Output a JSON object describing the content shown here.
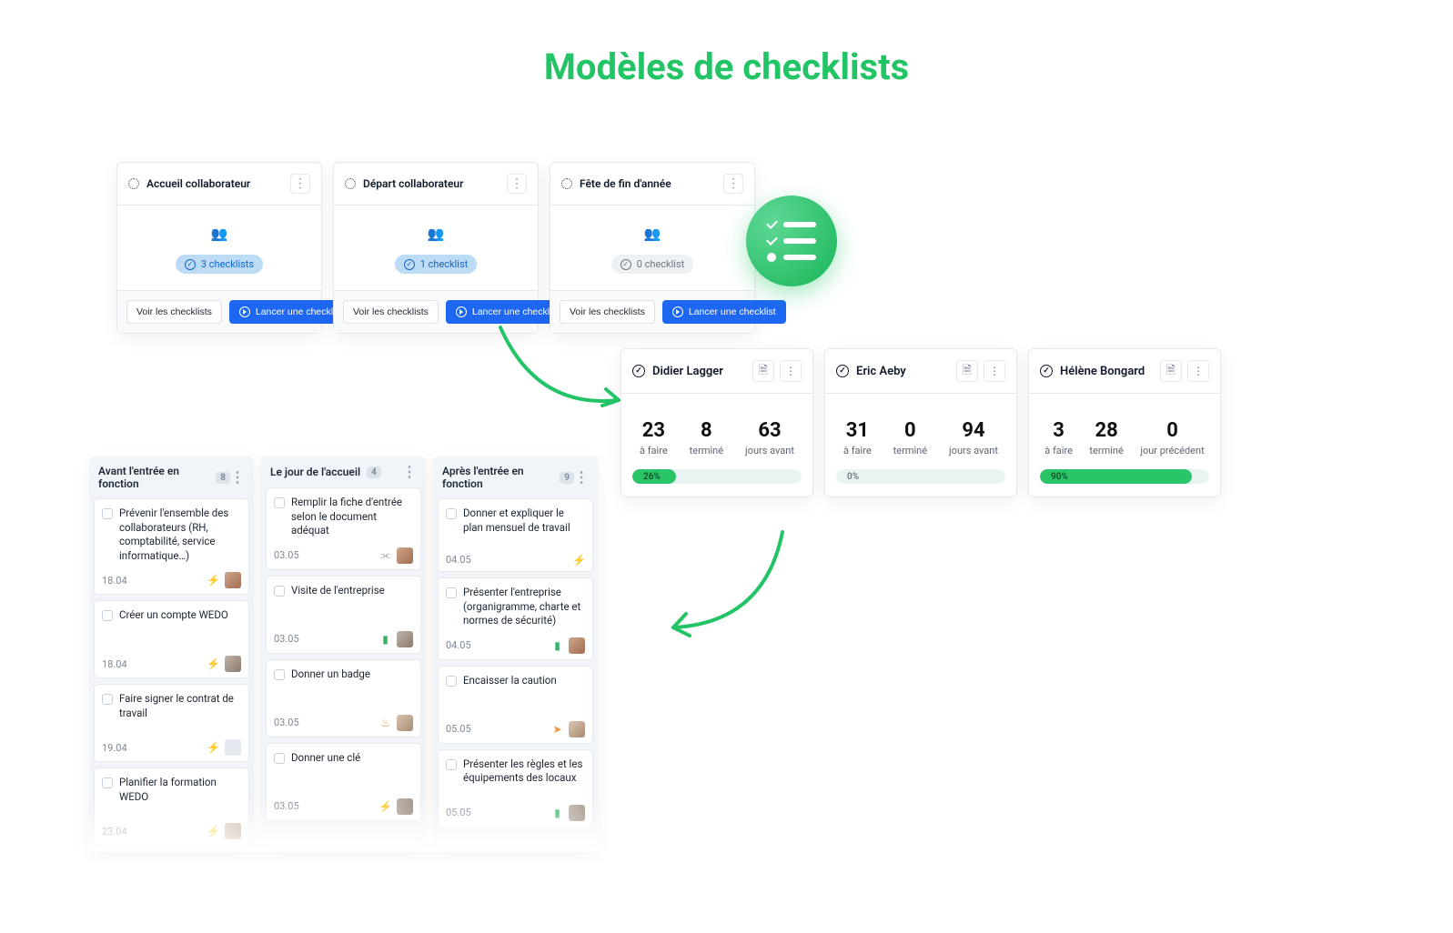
{
  "page_title": "Modèles de checklists",
  "templates": [
    {
      "title": "Accueil collaborateur",
      "chip_label": "3 checklists",
      "chip_style": "blue",
      "view_label": "Voir les checklists",
      "launch_label": "Lancer une checklist"
    },
    {
      "title": "Départ collaborateur",
      "chip_label": "1 checklist",
      "chip_style": "blue",
      "view_label": "Voir les checklists",
      "launch_label": "Lancer une checklist"
    },
    {
      "title": "Fête de fin d'année",
      "chip_label": "0 checklist",
      "chip_style": "grey",
      "view_label": "Voir les checklists",
      "launch_label": "Lancer une checklist"
    }
  ],
  "status_cards": [
    {
      "name": "Didier Lagger",
      "stats": [
        {
          "num": "23",
          "lbl": "à faire"
        },
        {
          "num": "8",
          "lbl": "terminé"
        },
        {
          "num": "63",
          "lbl": "jours avant"
        }
      ],
      "progress_pct": 26,
      "progress_label": "26%"
    },
    {
      "name": "Eric Aeby",
      "stats": [
        {
          "num": "31",
          "lbl": "à faire"
        },
        {
          "num": "0",
          "lbl": "terminé"
        },
        {
          "num": "94",
          "lbl": "jours avant"
        }
      ],
      "progress_pct": 0,
      "progress_label": "0%"
    },
    {
      "name": "Hélène Bongard",
      "stats": [
        {
          "num": "3",
          "lbl": "à faire"
        },
        {
          "num": "28",
          "lbl": "terminé"
        },
        {
          "num": "0",
          "lbl": "jour précédent"
        }
      ],
      "progress_pct": 90,
      "progress_label": "90%"
    }
  ],
  "kanban": {
    "columns": [
      {
        "title": "Avant l'entrée en fonction",
        "count": "8",
        "tasks": [
          {
            "title": "Prévenir l'ensemble des collaborateurs (RH, comptabilité, service informatique…)",
            "date": "18.04",
            "icons": [
              "bolt-orange"
            ],
            "avatar": "alt1"
          },
          {
            "title": "Créer un compte WEDO",
            "date": "18.04",
            "icons": [
              "bolt-orange"
            ],
            "avatar": "alt2"
          },
          {
            "title": "Faire signer le contrat de travail",
            "date": "19.04",
            "icons": [
              "bolt-orange"
            ],
            "avatar": "placeholder"
          },
          {
            "title": "Planifier la formation WEDO",
            "date": "23.04",
            "icons": [
              "bolt-orange"
            ],
            "avatar": "alt3"
          }
        ]
      },
      {
        "title": "Le jour de l'accueil",
        "count": "4",
        "tasks": [
          {
            "title": "Remplir la fiche d'entrée selon le document adéquat",
            "date": "03.05",
            "icons": [
              "attach"
            ],
            "avatar": "alt1"
          },
          {
            "title": "Visite de l'entreprise",
            "date": "03.05",
            "icons": [
              "flag-green"
            ],
            "avatar": "alt2"
          },
          {
            "title": "Donner un badge",
            "date": "03.05",
            "icons": [
              "flame-orange"
            ],
            "avatar": "alt3"
          },
          {
            "title": "Donner une clé",
            "date": "03.05",
            "icons": [
              "bolt-orange"
            ],
            "avatar": "alt2"
          }
        ]
      },
      {
        "title": "Après l'entrée en fonction",
        "count": "9",
        "tasks": [
          {
            "title": "Donner et expliquer le plan mensuel de travail",
            "date": "04.05",
            "icons": [
              "bolt-orange"
            ],
            "avatar": ""
          },
          {
            "title": "Présenter l'entreprise (organigramme, charte et normes de sécurité)",
            "date": "04.05",
            "icons": [
              "flag-green"
            ],
            "avatar": "alt1"
          },
          {
            "title": "Encaisser la caution",
            "date": "05.05",
            "icons": [
              "send-orange"
            ],
            "avatar": "alt3"
          },
          {
            "title": "Présenter les règles et les équipements des locaux",
            "date": "05.05",
            "icons": [
              "flag-green"
            ],
            "avatar": "alt2"
          }
        ]
      }
    ]
  }
}
